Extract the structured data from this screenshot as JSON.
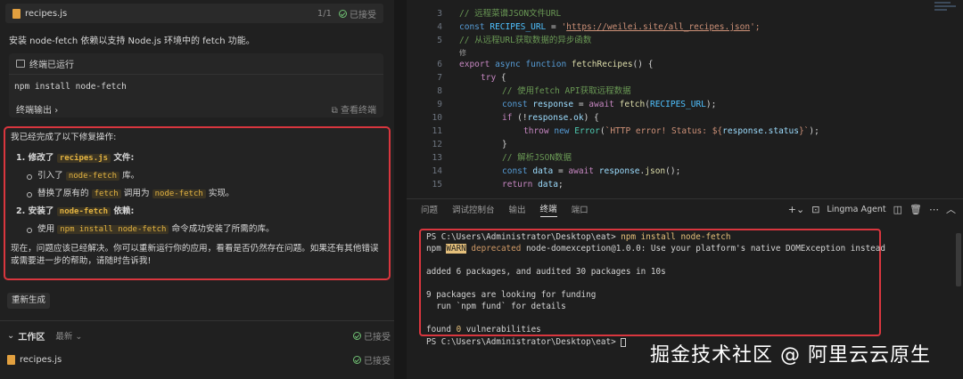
{
  "chat": {
    "top_file": {
      "name": "recipes.js",
      "count": "1/1",
      "status": "已接受"
    },
    "install_desc": "安装 node-fetch 依赖以支持 Node.js 环境中的 fetch 功能。",
    "terminal_card": {
      "title": "终端已运行",
      "command": "npm install node-fetch",
      "output_label": "终端输出",
      "view_label": "查看终端"
    },
    "summary": {
      "heading": "我已经完成了以下修复操作:",
      "item1_num": "1.",
      "item1_a": "修改了",
      "item1_code": "recipes.js",
      "item1_b": "文件:",
      "sub1_a": "引入了",
      "sub1_code": "node-fetch",
      "sub1_b": "库。",
      "sub2_a": "替换了原有的",
      "sub2_code1": "fetch",
      "sub2_b": "调用为",
      "sub2_code2": "node-fetch",
      "sub2_c": "实现。",
      "item2_num": "2.",
      "item2_a": "安装了",
      "item2_code": "node-fetch",
      "item2_b": "依赖:",
      "sub3_a": "使用",
      "sub3_code": "npm install node-fetch",
      "sub3_b": "命令成功安装了所需的库。",
      "footer": "现在，问题应该已经解决。你可以重新运行你的应用，看看是否仍然存在问题。如果还有其他错误或需要进一步的帮助，请随时告诉我!"
    },
    "regenerate_label": "重新生成",
    "workspace": {
      "title": "工作区",
      "latest": "最新",
      "status": "已接受"
    },
    "workspace_file": {
      "name": "recipes.js",
      "status": "已接受"
    }
  },
  "editor": {
    "lines": [
      {
        "num": "3",
        "comment": "// 远程菜谱JSON文件URL"
      },
      {
        "num": "4",
        "const_kw": "const",
        "name": "RECIPES_URL",
        "eq": " = ",
        "q1": "'",
        "url": "https://weilei.site/all_recipes.json",
        "q2": "';"
      },
      {
        "num": "5",
        "comment": "// 从远程URL获取数据的异步函数"
      },
      {
        "num": "",
        "marker": "修"
      },
      {
        "num": "6",
        "export_kw": "export",
        "async_kw": "async",
        "function_kw": "function",
        "fname": "fetchRecipes",
        "rest": "() {"
      },
      {
        "num": "7",
        "try_kw": "try",
        "rest": " {"
      },
      {
        "num": "8",
        "comment": "// 使用fetch API获取远程数据"
      },
      {
        "num": "9",
        "const_kw": "const",
        "var": "response",
        "eq": " = ",
        "await_kw": "await",
        "fname": "fetch",
        "arg": "RECIPES_URL",
        "rest": ");"
      },
      {
        "num": "10",
        "if_kw": "if",
        "open": " (!",
        "var": "response",
        "dot": ".",
        "prop": "ok",
        "rest": ") {"
      },
      {
        "num": "11",
        "throw_kw": "throw",
        "new_kw": "new",
        "cls": "Error",
        "str1": "`HTTP error! Status: ${",
        "var": "response.status",
        "str2": "}`",
        "rest": ");"
      },
      {
        "num": "12",
        "rest": "}"
      },
      {
        "num": "13",
        "comment": "// 解析JSON数据"
      },
      {
        "num": "14",
        "const_kw": "const",
        "var": "data",
        "eq": " = ",
        "await_kw": "await",
        "obj": "response",
        "fname": "json",
        "rest": "();"
      },
      {
        "num": "15",
        "return_kw": "return",
        "var": "data",
        "rest": ";"
      }
    ]
  },
  "panel": {
    "tabs": [
      "问题",
      "调试控制台",
      "输出",
      "终端",
      "端口"
    ],
    "active_tab": "终端",
    "agent_label": "Lingma Agent"
  },
  "terminal": {
    "prompt1": "PS C:\\Users\\Administrator\\Desktop\\eat> ",
    "cmd1": "npm install node-fetch",
    "warn_prefix": "npm ",
    "warn": "WARN",
    "deprecated": " deprecated",
    "warn_rest": " node-domexception@1.0.0: Use your platform's native DOMException instead",
    "added": "added 6 packages, and audited 30 packages in 10s",
    "funding1": "9 packages are looking for funding",
    "funding2": "  run `npm fund` for details",
    "found_a": "found ",
    "found_num": "0",
    "found_b": " vulnerabilities",
    "prompt2": "PS C:\\Users\\Administrator\\Desktop\\eat> "
  },
  "watermark": "掘金技术社区 @ 阿里云云原生",
  "colors": {
    "highlight_border": "#d9363e",
    "accept_green": "#6fbf73",
    "code_yellow": "#e3b341"
  }
}
